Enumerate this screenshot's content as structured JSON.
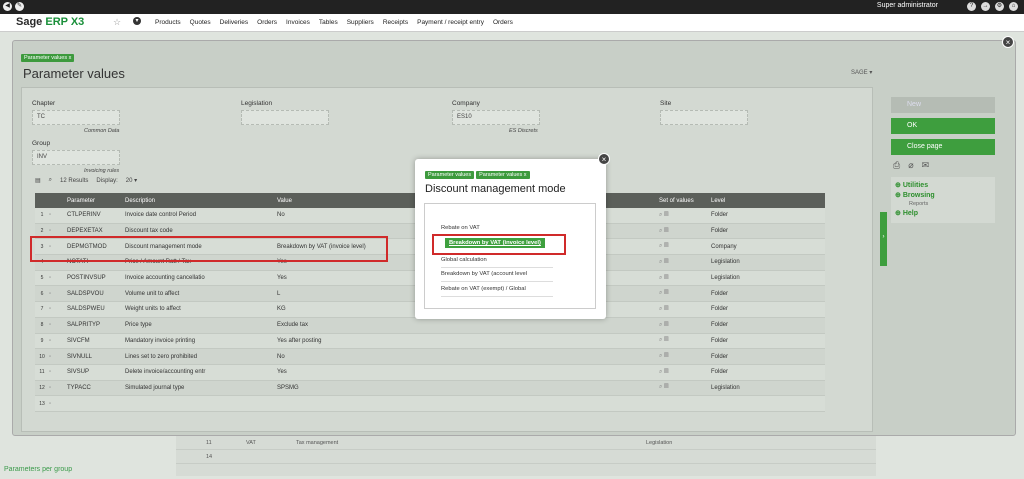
{
  "topbar": {
    "user": "Super administrator"
  },
  "nav": {
    "brand_a": "Sage ",
    "brand_b": "ERP X3",
    "items": [
      "Products",
      "Quotes",
      "Deliveries",
      "Orders",
      "Invoices",
      "Tables",
      "Suppliers",
      "Receipts",
      "Payment / receipt entry",
      "Orders"
    ]
  },
  "window": {
    "breadcrumb": "Parameter values",
    "title": "Parameter values",
    "sage": "SAGE",
    "fields": {
      "chapter_label": "Chapter",
      "chapter_value": "TC",
      "chapter_desc": "Common Data",
      "legislation_label": "Legislation",
      "company_label": "Company",
      "company_value": "ES10",
      "company_desc": "ES Discrets",
      "site_label": "Site",
      "group_label": "Group",
      "group_value": "INV",
      "group_desc": "Invoicing rules"
    },
    "results": "12 Results",
    "display_label": "Display:",
    "display_value": "20",
    "columns": [
      "Parameter",
      "Description",
      "Value",
      "Set of values",
      "Level"
    ],
    "rows": [
      {
        "n": "1",
        "param": "CTLPERINV",
        "desc": "Invoice date control Period",
        "value": "No",
        "level": "Folder"
      },
      {
        "n": "2",
        "param": "DEPEXETAX",
        "desc": "Discount tax code",
        "value": "",
        "level": "Folder"
      },
      {
        "n": "3",
        "param": "DEPMGTMOD",
        "desc": "Discount management mode",
        "value": "Breakdown by VAT (invoice level)",
        "level": "Company"
      },
      {
        "n": "4",
        "param": "NOTATI",
        "desc": "Price / Amount Ratt / Tax",
        "value": "Yes",
        "level": "Legislation"
      },
      {
        "n": "5",
        "param": "POSTINVSUP",
        "desc": "Invoice accounting cancellatio",
        "value": "Yes",
        "level": "Legislation"
      },
      {
        "n": "6",
        "param": "SALDSPVOU",
        "desc": "Volume unit to affect",
        "value": "L",
        "level": "Folder"
      },
      {
        "n": "7",
        "param": "SALDSPWEU",
        "desc": "Weight units to affect",
        "value": "KG",
        "level": "Folder"
      },
      {
        "n": "8",
        "param": "SALPRITYP",
        "desc": "Price type",
        "value": "Exclude tax",
        "level": "Folder"
      },
      {
        "n": "9",
        "param": "SIVCFM",
        "desc": "Mandatory invoice printing",
        "value": "Yes after posting",
        "level": "Folder"
      },
      {
        "n": "10",
        "param": "SIVNULL",
        "desc": "Lines set to zero prohibited",
        "value": "No",
        "level": "Folder"
      },
      {
        "n": "11",
        "param": "SIVSUP",
        "desc": "Delete invoice/accounting entr",
        "value": "Yes",
        "level": "Folder"
      },
      {
        "n": "12",
        "param": "TYPACC",
        "desc": "Simulated journal type",
        "value": "SPSMG",
        "level": "Legislation"
      },
      {
        "n": "13",
        "param": "",
        "desc": "",
        "value": "",
        "level": ""
      }
    ]
  },
  "right_panel": {
    "new": "New",
    "ok": "OK",
    "close_page": "Close page",
    "utilities": "Utilities",
    "browsing": "Browsing",
    "reports": "Reports",
    "help": "Help"
  },
  "background": {
    "bottom_link": "Parameters per group",
    "lower_row1_n": "11",
    "lower_row1_code": "VAT",
    "lower_row1_desc": "Tax management",
    "lower_row1_level": "Legislation",
    "lower_row2_n": "14"
  },
  "dialog": {
    "breadcrumb1": "Parameter values",
    "breadcrumb2": "Parameter values",
    "title": "Discount management mode",
    "options": [
      "Rebate on VAT",
      "Breakdown by VAT (invoice level)",
      "Global calculation",
      "Breakdown by VAT (account level",
      "Rebate on VAT (exempt) / Global"
    ],
    "selected_index": 1
  }
}
